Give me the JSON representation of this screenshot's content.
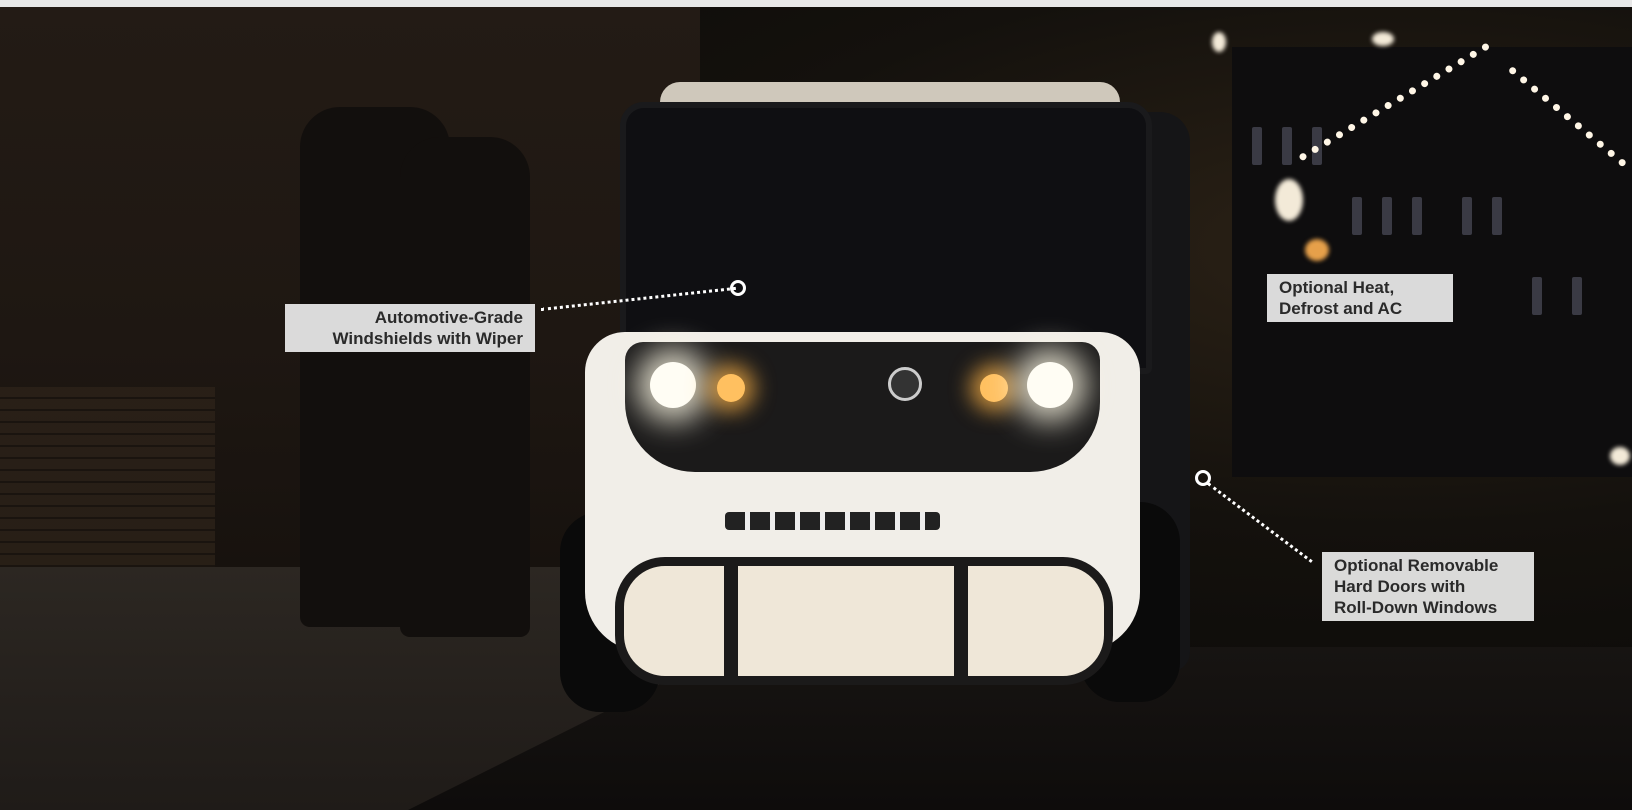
{
  "callouts": [
    {
      "id": "windshield",
      "label_line1": "Automotive-Grade",
      "label_line2": "Windshields with Wiper",
      "label_line3": ""
    },
    {
      "id": "climate",
      "label_line1": "Optional Heat,",
      "label_line2": "Defrost and AC",
      "label_line3": ""
    },
    {
      "id": "doors",
      "label_line1": "Optional Removable",
      "label_line2": "Hard Doors with",
      "label_line3": "Roll-Down Windows"
    }
  ],
  "colors": {
    "label_bg": "#ececec",
    "label_text": "#2a2a2a",
    "marker": "#ffffff"
  },
  "image": {
    "subject": "white electric low-speed vehicle at night",
    "icons": [
      "callout-marker-icon"
    ]
  }
}
